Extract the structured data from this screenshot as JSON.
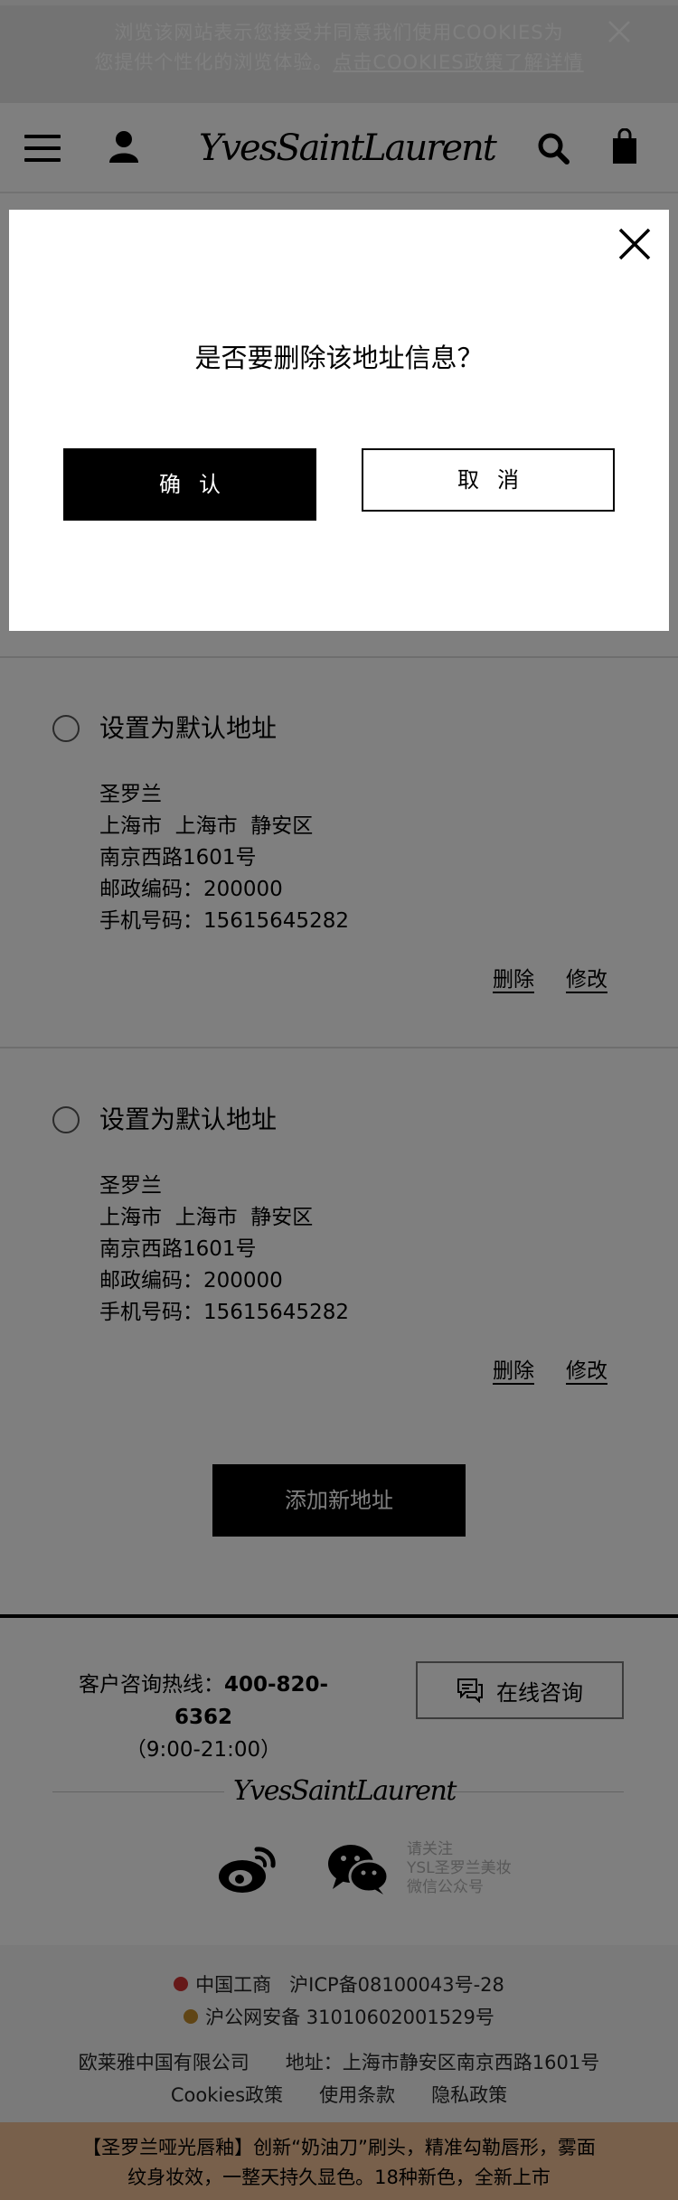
{
  "cookie_banner": {
    "line1": "浏览该网站表示您接受并同意我们使用COOKIES为",
    "line2_prefix": "您提供个性化的浏览体验。",
    "line2_link": "点击COOKIES政策了解详情"
  },
  "header": {
    "logo": "YvesSaintLaurent"
  },
  "addresses": [
    {
      "default_label": "设置为默认地址",
      "name": "圣罗兰",
      "region": "上海市  上海市  静安区",
      "street": "南京西路1601号",
      "postal": "邮政编码：200000",
      "phone": "手机号码：15615645282",
      "delete_label": "删除",
      "edit_label": "修改"
    },
    {
      "default_label": "设置为默认地址",
      "name": "圣罗兰",
      "region": "上海市  上海市  静安区",
      "street": "南京西路1601号",
      "postal": "邮政编码：200000",
      "phone": "手机号码：15615645282",
      "delete_label": "删除",
      "edit_label": "修改"
    }
  ],
  "add_address_label": "添加新地址",
  "footer": {
    "hotline_prefix": "客户咨询热线：",
    "hotline_number": "400-820-6362",
    "hotline_hours": "（9:00-21:00）",
    "consult_label": "在线咨询",
    "logo": "YvesSaintLaurent",
    "wechat_note": [
      "请关注",
      "YSL圣罗兰美妆",
      "微信公众号"
    ],
    "legal": {
      "icp_org": "中国工商",
      "icp": "沪ICP备08100043号-28",
      "police": "沪公网安备 31010602001529号",
      "company": "欧莱雅中国有限公司",
      "address": "地址：上海市静安区南京西路1601号",
      "cookies": "Cookies政策",
      "terms": "使用条款",
      "privacy": "隐私政策"
    },
    "promo": [
      "【圣罗兰哑光唇釉】创新“奶油刀”刷头，精准勾勒唇形，雾面",
      "纹身妆效，一整天持久显色。18种新色，全新上市"
    ]
  },
  "modal": {
    "question": "是否要删除该地址信息？",
    "confirm_label": "确认",
    "cancel_label": "取消"
  },
  "colors": {
    "overlay": "#808080",
    "brand_black": "#000000",
    "promo_bg": "#f0c097"
  }
}
